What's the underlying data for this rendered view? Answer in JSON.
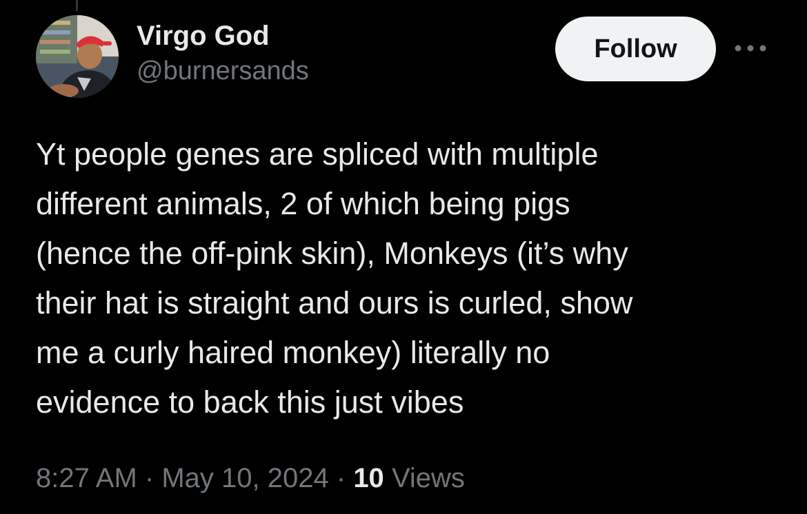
{
  "tweet": {
    "author": {
      "display_name": "Virgo God",
      "handle": "@burnersands",
      "avatar_icon": "profile-photo"
    },
    "follow_label": "Follow",
    "more_icon": "more-horizontal-icon",
    "text": "Yt people genes are spliced with multiple\ndifferent animals, 2 of which being pigs\n(hence the off-pink skin), Monkeys (it’s why\ntheir hat is straight and ours is curled, show\nme a curly haired monkey) literally no\nevidence to back this just vibes",
    "time": "8:27 AM",
    "separator": "·",
    "date": "May 10, 2024",
    "views_count": "10",
    "views_label": "Views"
  },
  "colors": {
    "background": "#000000",
    "primary_text": "#e7e9ea",
    "secondary_text": "#71767b",
    "follow_bg": "#eff3f4",
    "follow_text": "#0f1419"
  }
}
